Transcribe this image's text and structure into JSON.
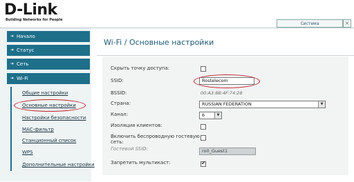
{
  "header": {
    "logo_text": "D-Link",
    "tagline": "Building Networks for People",
    "system_button": "Система",
    "close_symbol": "×"
  },
  "sidebar": {
    "sections": [
      {
        "label": "Начало"
      },
      {
        "label": "Статус"
      },
      {
        "label": "Сеть"
      },
      {
        "label": "Wi-Fi"
      }
    ],
    "wifi_items": [
      {
        "label": "Общие настройки"
      },
      {
        "label": "Основные настройки"
      },
      {
        "label": "Настройки безопасности"
      },
      {
        "label": "MAC-фильтр"
      },
      {
        "label": "Станционный список"
      },
      {
        "label": "WPS"
      },
      {
        "label": "Дополнительные настройки"
      }
    ],
    "arrow_symbol": "➜"
  },
  "page": {
    "title": "Wi-Fi / Основные настройки"
  },
  "form": {
    "hide_ap_label": "Скрыть точку доступа:",
    "hide_ap_checked": false,
    "ssid_label": "SSID:",
    "ssid_value": "Rostelecom",
    "bssid_label": "BSSID:",
    "bssid_value": "00:A3:8B:4F:74:28",
    "country_label": "Страна:",
    "country_value": "RUSSIAN FEDERATION",
    "channel_label": "Канал:",
    "channel_value": "6",
    "client_isolation_label": "Изоляция клиентов:",
    "client_isolation_checked": false,
    "guest_enable_label_1": "Включить беспроводную гостевую",
    "guest_enable_label_2": "сеть:",
    "guest_enable_checked": false,
    "guest_ssid_label": "Гостевой SSID:",
    "guest_ssid_value": "ro0_Guest1",
    "multicast_label": "Запретить мультикаст:",
    "multicast_checked": true
  },
  "colors": {
    "nav_bg": "#1e6f8a",
    "highlight_ring": "#c0202a",
    "title_blue": "#1e5a75"
  }
}
